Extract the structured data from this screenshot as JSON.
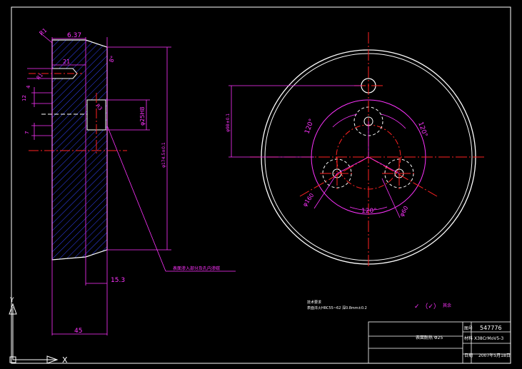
{
  "drawing": {
    "dims": {
      "chamfer_top": "R1",
      "top_width": "6.37",
      "angle_top": "8°",
      "dim_21": "21",
      "r_label": "R1",
      "small_a": "4",
      "small_b": "12",
      "small_c": "7",
      "hole_h8": "φ25H8",
      "diam_face": "φ174.5±0.1",
      "slot_pos": "15.3",
      "bottom_width": "45",
      "r_pos": "R3",
      "right_height": "φ98±0.1",
      "pcd": "φ160",
      "pcd_small": "φ60",
      "angle_a": "120°",
      "angle_b": "120°",
      "angle_c": "120°"
    },
    "leader_note": "表面渗入部分及孔内渗碳",
    "tech_title": "技术要求",
    "tech_line": "表面淬火HRC55~62 深0.8mm±0.2",
    "roughness_note": "其余",
    "roughness_value": "✓ （✓）"
  },
  "title_block": {
    "part_name": "表面耐热  Φ25",
    "labels": {
      "drawing_no": "图号",
      "material": "材料",
      "date": "日期"
    },
    "values": {
      "drawing_no": "547776",
      "material": "X38CrMoV5-3",
      "date": "2007年5月18日"
    }
  },
  "ucs": {
    "x_label": "X",
    "y_label": "Y"
  },
  "colors": {
    "background": "#000000",
    "outline": "#ffffff",
    "dimension": "#ff33ff",
    "centerline": "#ff2222",
    "hatch": "#3344ff",
    "hidden": "#ffffff"
  }
}
